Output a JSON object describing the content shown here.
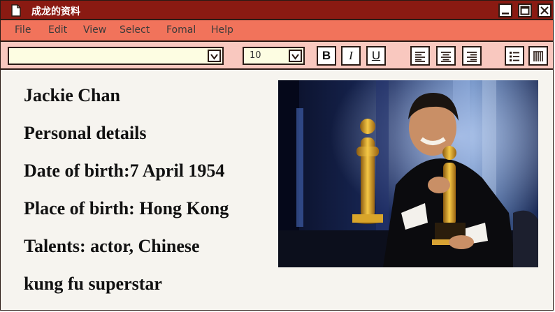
{
  "window": {
    "title": "成龙的资料"
  },
  "menu": {
    "items": [
      {
        "label": "File"
      },
      {
        "label": "Edit"
      },
      {
        "label": "View"
      },
      {
        "label": "Select"
      },
      {
        "label": "Fomal"
      },
      {
        "label": "Help"
      }
    ]
  },
  "toolbar": {
    "font_value": "",
    "size_value": "10",
    "bold_label": "B",
    "italic_label": "I",
    "underline_label": "U"
  },
  "document": {
    "lines": [
      "Jackie Chan",
      "Personal details",
      "Date of birth:7 April 1954",
      "Place of birth: Hong Kong",
      "Talents: actor, Chinese",
      "kung fu superstar"
    ]
  },
  "photo": {
    "icon": "photo-jackie-chan-oscar"
  },
  "colors": {
    "title_bar": "#8a1a12",
    "menu_bar": "#f1735b",
    "toolbar": "#f9c8bf",
    "page": "#f6f4ef",
    "border": "#2a1a14"
  }
}
